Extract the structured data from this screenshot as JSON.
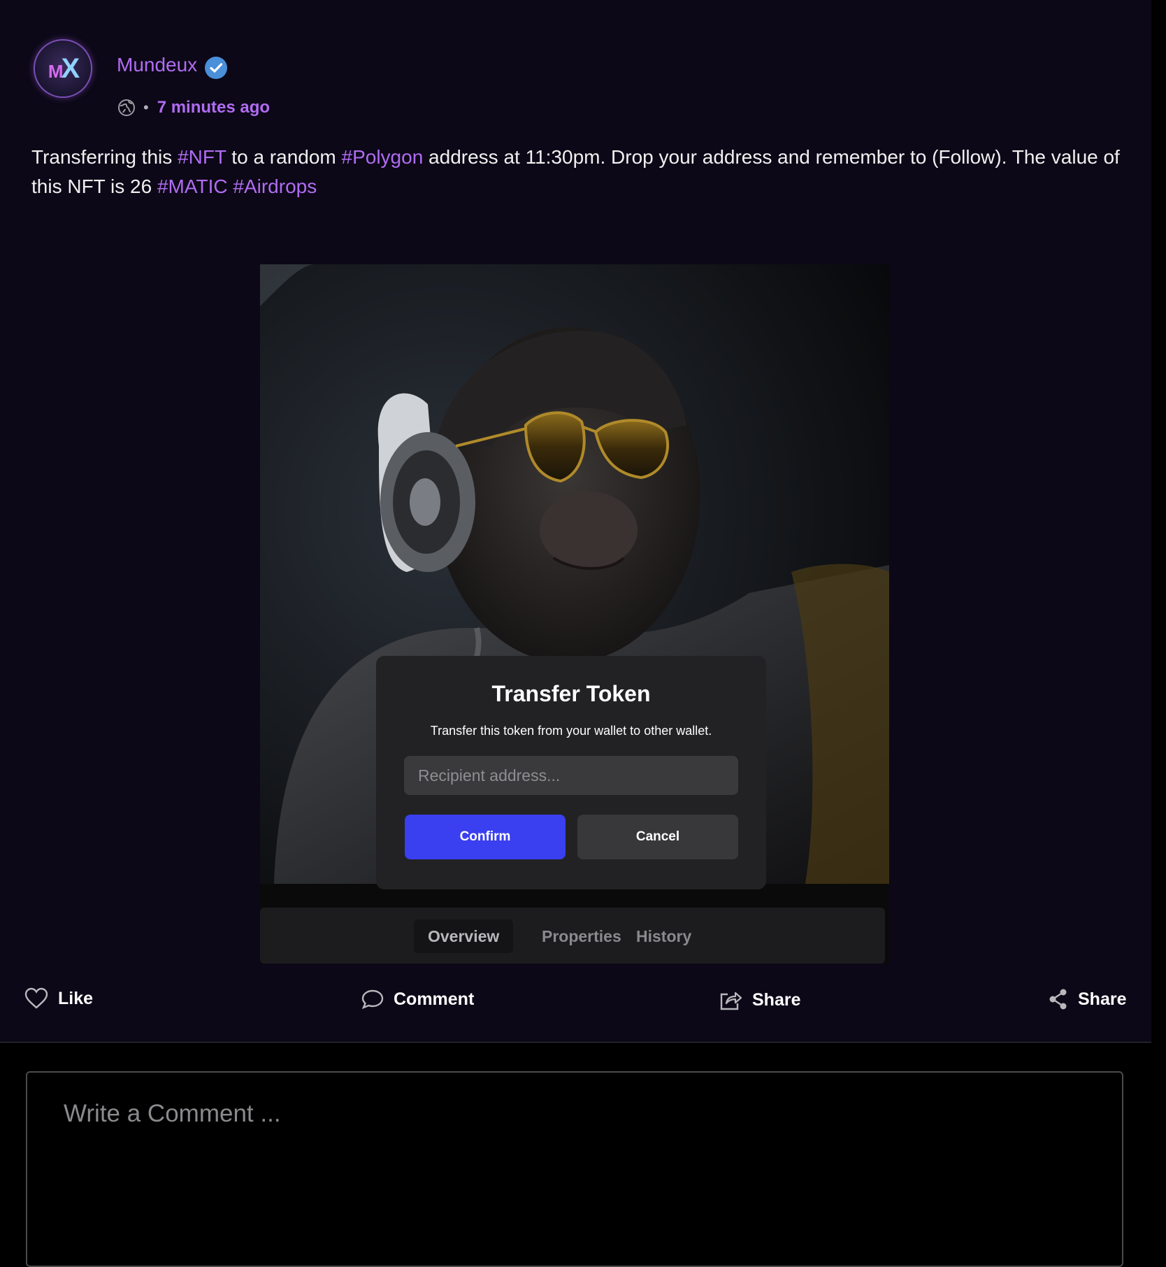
{
  "post": {
    "author": "Mundeux",
    "verified": true,
    "avatar_text_m": "M",
    "avatar_text_x": "X",
    "visibility_icon": "globe-icon",
    "time": "7 minutes ago",
    "text_parts": [
      {
        "t": "Transferring this ",
        "tag": false
      },
      {
        "t": "#NFT",
        "tag": true
      },
      {
        "t": " to a random ",
        "tag": false
      },
      {
        "t": "#Polygon",
        "tag": true
      },
      {
        "t": " address at 11:30pm. Drop your address and remember to (Follow). The value of this NFT is 26 ",
        "tag": false
      },
      {
        "t": "#MATIC",
        "tag": true
      },
      {
        "t": " ",
        "tag": false
      },
      {
        "t": "#Airdrops",
        "tag": true
      }
    ]
  },
  "nft_tabs": {
    "items": [
      {
        "label": "Overview",
        "active": true
      },
      {
        "label": "Properties",
        "active": false
      },
      {
        "label": "History",
        "active": false
      }
    ]
  },
  "modal": {
    "title": "Transfer Token",
    "description": "Transfer this token from your wallet to other wallet.",
    "recipient_placeholder": "Recipient address...",
    "recipient_value": "",
    "confirm_label": "Confirm",
    "cancel_label": "Cancel"
  },
  "actions": {
    "like": "Like",
    "comment": "Comment",
    "share": "Share",
    "share2": "Share"
  },
  "comment": {
    "placeholder": "Write a Comment ..."
  },
  "colors": {
    "accent": "#b06cf2",
    "confirm": "#3a3ff0",
    "post_bg": "#0c0817",
    "modal_bg": "#222224"
  }
}
